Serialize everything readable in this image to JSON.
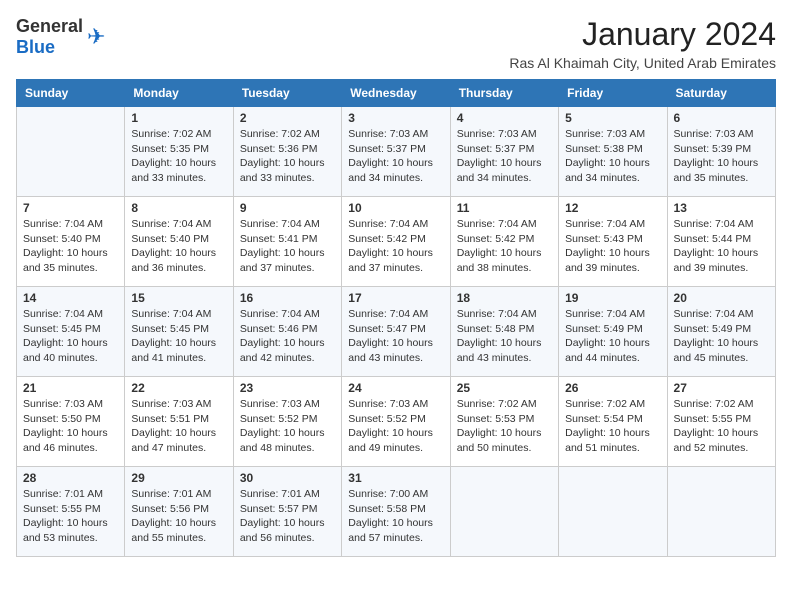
{
  "logo": {
    "text_general": "General",
    "text_blue": "Blue"
  },
  "title": "January 2024",
  "subtitle": "Ras Al Khaimah City, United Arab Emirates",
  "days_of_week": [
    "Sunday",
    "Monday",
    "Tuesday",
    "Wednesday",
    "Thursday",
    "Friday",
    "Saturday"
  ],
  "weeks": [
    [
      {
        "day": "",
        "sunrise": "",
        "sunset": "",
        "daylight": ""
      },
      {
        "day": "1",
        "sunrise": "Sunrise: 7:02 AM",
        "sunset": "Sunset: 5:35 PM",
        "daylight": "Daylight: 10 hours and 33 minutes."
      },
      {
        "day": "2",
        "sunrise": "Sunrise: 7:02 AM",
        "sunset": "Sunset: 5:36 PM",
        "daylight": "Daylight: 10 hours and 33 minutes."
      },
      {
        "day": "3",
        "sunrise": "Sunrise: 7:03 AM",
        "sunset": "Sunset: 5:37 PM",
        "daylight": "Daylight: 10 hours and 34 minutes."
      },
      {
        "day": "4",
        "sunrise": "Sunrise: 7:03 AM",
        "sunset": "Sunset: 5:37 PM",
        "daylight": "Daylight: 10 hours and 34 minutes."
      },
      {
        "day": "5",
        "sunrise": "Sunrise: 7:03 AM",
        "sunset": "Sunset: 5:38 PM",
        "daylight": "Daylight: 10 hours and 34 minutes."
      },
      {
        "day": "6",
        "sunrise": "Sunrise: 7:03 AM",
        "sunset": "Sunset: 5:39 PM",
        "daylight": "Daylight: 10 hours and 35 minutes."
      }
    ],
    [
      {
        "day": "7",
        "sunrise": "Sunrise: 7:04 AM",
        "sunset": "Sunset: 5:40 PM",
        "daylight": "Daylight: 10 hours and 35 minutes."
      },
      {
        "day": "8",
        "sunrise": "Sunrise: 7:04 AM",
        "sunset": "Sunset: 5:40 PM",
        "daylight": "Daylight: 10 hours and 36 minutes."
      },
      {
        "day": "9",
        "sunrise": "Sunrise: 7:04 AM",
        "sunset": "Sunset: 5:41 PM",
        "daylight": "Daylight: 10 hours and 37 minutes."
      },
      {
        "day": "10",
        "sunrise": "Sunrise: 7:04 AM",
        "sunset": "Sunset: 5:42 PM",
        "daylight": "Daylight: 10 hours and 37 minutes."
      },
      {
        "day": "11",
        "sunrise": "Sunrise: 7:04 AM",
        "sunset": "Sunset: 5:42 PM",
        "daylight": "Daylight: 10 hours and 38 minutes."
      },
      {
        "day": "12",
        "sunrise": "Sunrise: 7:04 AM",
        "sunset": "Sunset: 5:43 PM",
        "daylight": "Daylight: 10 hours and 39 minutes."
      },
      {
        "day": "13",
        "sunrise": "Sunrise: 7:04 AM",
        "sunset": "Sunset: 5:44 PM",
        "daylight": "Daylight: 10 hours and 39 minutes."
      }
    ],
    [
      {
        "day": "14",
        "sunrise": "Sunrise: 7:04 AM",
        "sunset": "Sunset: 5:45 PM",
        "daylight": "Daylight: 10 hours and 40 minutes."
      },
      {
        "day": "15",
        "sunrise": "Sunrise: 7:04 AM",
        "sunset": "Sunset: 5:45 PM",
        "daylight": "Daylight: 10 hours and 41 minutes."
      },
      {
        "day": "16",
        "sunrise": "Sunrise: 7:04 AM",
        "sunset": "Sunset: 5:46 PM",
        "daylight": "Daylight: 10 hours and 42 minutes."
      },
      {
        "day": "17",
        "sunrise": "Sunrise: 7:04 AM",
        "sunset": "Sunset: 5:47 PM",
        "daylight": "Daylight: 10 hours and 43 minutes."
      },
      {
        "day": "18",
        "sunrise": "Sunrise: 7:04 AM",
        "sunset": "Sunset: 5:48 PM",
        "daylight": "Daylight: 10 hours and 43 minutes."
      },
      {
        "day": "19",
        "sunrise": "Sunrise: 7:04 AM",
        "sunset": "Sunset: 5:49 PM",
        "daylight": "Daylight: 10 hours and 44 minutes."
      },
      {
        "day": "20",
        "sunrise": "Sunrise: 7:04 AM",
        "sunset": "Sunset: 5:49 PM",
        "daylight": "Daylight: 10 hours and 45 minutes."
      }
    ],
    [
      {
        "day": "21",
        "sunrise": "Sunrise: 7:03 AM",
        "sunset": "Sunset: 5:50 PM",
        "daylight": "Daylight: 10 hours and 46 minutes."
      },
      {
        "day": "22",
        "sunrise": "Sunrise: 7:03 AM",
        "sunset": "Sunset: 5:51 PM",
        "daylight": "Daylight: 10 hours and 47 minutes."
      },
      {
        "day": "23",
        "sunrise": "Sunrise: 7:03 AM",
        "sunset": "Sunset: 5:52 PM",
        "daylight": "Daylight: 10 hours and 48 minutes."
      },
      {
        "day": "24",
        "sunrise": "Sunrise: 7:03 AM",
        "sunset": "Sunset: 5:52 PM",
        "daylight": "Daylight: 10 hours and 49 minutes."
      },
      {
        "day": "25",
        "sunrise": "Sunrise: 7:02 AM",
        "sunset": "Sunset: 5:53 PM",
        "daylight": "Daylight: 10 hours and 50 minutes."
      },
      {
        "day": "26",
        "sunrise": "Sunrise: 7:02 AM",
        "sunset": "Sunset: 5:54 PM",
        "daylight": "Daylight: 10 hours and 51 minutes."
      },
      {
        "day": "27",
        "sunrise": "Sunrise: 7:02 AM",
        "sunset": "Sunset: 5:55 PM",
        "daylight": "Daylight: 10 hours and 52 minutes."
      }
    ],
    [
      {
        "day": "28",
        "sunrise": "Sunrise: 7:01 AM",
        "sunset": "Sunset: 5:55 PM",
        "daylight": "Daylight: 10 hours and 53 minutes."
      },
      {
        "day": "29",
        "sunrise": "Sunrise: 7:01 AM",
        "sunset": "Sunset: 5:56 PM",
        "daylight": "Daylight: 10 hours and 55 minutes."
      },
      {
        "day": "30",
        "sunrise": "Sunrise: 7:01 AM",
        "sunset": "Sunset: 5:57 PM",
        "daylight": "Daylight: 10 hours and 56 minutes."
      },
      {
        "day": "31",
        "sunrise": "Sunrise: 7:00 AM",
        "sunset": "Sunset: 5:58 PM",
        "daylight": "Daylight: 10 hours and 57 minutes."
      },
      {
        "day": "",
        "sunrise": "",
        "sunset": "",
        "daylight": ""
      },
      {
        "day": "",
        "sunrise": "",
        "sunset": "",
        "daylight": ""
      },
      {
        "day": "",
        "sunrise": "",
        "sunset": "",
        "daylight": ""
      }
    ]
  ]
}
